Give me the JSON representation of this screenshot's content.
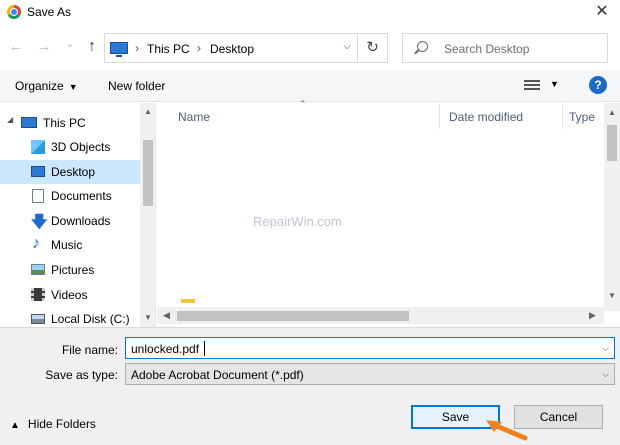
{
  "window": {
    "title": "Save As",
    "close_label": "✕"
  },
  "nav": {
    "back_glyph": "←",
    "forward_glyph": "→",
    "recent_glyph": "⌄",
    "up_glyph": "↑",
    "breadcrumb": [
      "This PC",
      "Desktop"
    ],
    "crumb_sep": "›",
    "refresh_glyph": "↻",
    "search_placeholder": "Search Desktop"
  },
  "toolbar": {
    "organize_label": "Organize",
    "new_folder_label": "New folder",
    "help_label": "?"
  },
  "sidebar": {
    "items": [
      {
        "label": "This PC",
        "icon": "pc-icon"
      },
      {
        "label": "3D Objects",
        "icon": "cube-icon"
      },
      {
        "label": "Desktop",
        "icon": "desktop-icon",
        "selected": true
      },
      {
        "label": "Documents",
        "icon": "documents-icon"
      },
      {
        "label": "Downloads",
        "icon": "downloads-icon"
      },
      {
        "label": "Music",
        "icon": "music-icon"
      },
      {
        "label": "Pictures",
        "icon": "pictures-icon"
      },
      {
        "label": "Videos",
        "icon": "videos-icon"
      },
      {
        "label": "Local Disk (C:)",
        "icon": "disk-icon"
      }
    ]
  },
  "filelist": {
    "columns": [
      "Name",
      "Date modified",
      "Type"
    ],
    "watermark": "RepairWin.com"
  },
  "form": {
    "file_name_label": "File name:",
    "file_name_value": "unlocked.pdf",
    "save_type_label": "Save as type:",
    "save_type_value": "Adobe Acrobat Document (*.pdf)"
  },
  "footer": {
    "hide_folders_label": "Hide Folders",
    "save_label": "Save",
    "cancel_label": "Cancel"
  },
  "colors": {
    "accent": "#0078d7",
    "selected": "#cce8ff",
    "annotation_arrow": "#f0821e"
  }
}
